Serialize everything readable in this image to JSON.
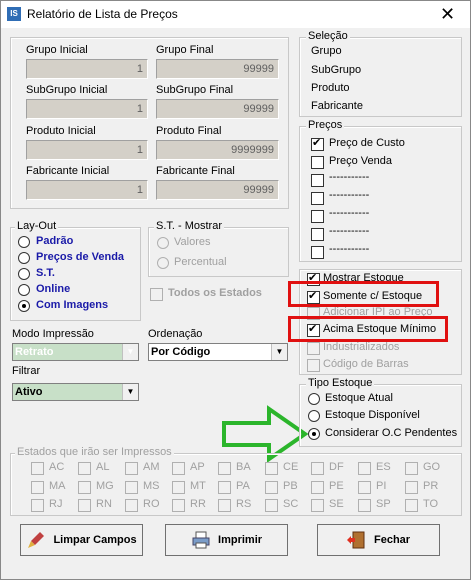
{
  "window": {
    "title": "Relatório de Lista de Preços",
    "icon_text": "IS",
    "close_glyph": "✕"
  },
  "ranges": {
    "grupo_inicial": {
      "label": "Grupo Inicial",
      "value": "1"
    },
    "grupo_final": {
      "label": "Grupo Final",
      "value": "99999"
    },
    "subgrupo_inicial": {
      "label": "SubGrupo Inicial",
      "value": "1"
    },
    "subgrupo_final": {
      "label": "SubGrupo Final",
      "value": "99999"
    },
    "produto_inicial": {
      "label": "Produto Inicial",
      "value": "1"
    },
    "produto_final": {
      "label": "Produto Final",
      "value": "9999999"
    },
    "fabricante_inicial": {
      "label": "Fabricante Inicial",
      "value": "1"
    },
    "fabricante_final": {
      "label": "Fabricante Final",
      "value": "99999"
    }
  },
  "selecao": {
    "title": "Seleção",
    "items": [
      "Grupo",
      "SubGrupo",
      "Produto",
      "Fabricante"
    ]
  },
  "precos": {
    "title": "Preços",
    "items": [
      {
        "label": "Preço de Custo",
        "checked": true
      },
      {
        "label": "Preço Venda",
        "checked": false
      },
      {
        "label": "-----------",
        "checked": false
      },
      {
        "label": "-----------",
        "checked": false
      },
      {
        "label": "-----------",
        "checked": false
      },
      {
        "label": "-----------",
        "checked": false
      },
      {
        "label": "-----------",
        "checked": false
      }
    ]
  },
  "layout": {
    "title": "Lay-Out",
    "options": [
      "Padrão",
      "Preços de Venda",
      "S.T.",
      "Online",
      "Com Imagens"
    ],
    "selected": 4
  },
  "st_mostrar": {
    "title": "S.T. - Mostrar",
    "options": [
      "Valores",
      "Percentual"
    ]
  },
  "todos_estados": "Todos os Estados",
  "opcoes": [
    {
      "label": "Mostrar Estoque",
      "checked": true,
      "disabled": false
    },
    {
      "label": "Somente c/ Estoque",
      "checked": true,
      "disabled": false
    },
    {
      "label": "Adicionar IPI ao Preço",
      "checked": false,
      "disabled": true
    },
    {
      "label": "Acima Estoque Mínimo",
      "checked": true,
      "disabled": false
    },
    {
      "label": "Industrializados",
      "checked": false,
      "disabled": true
    },
    {
      "label": "Código de Barras",
      "checked": false,
      "disabled": true
    }
  ],
  "modo_impressao": {
    "label": "Modo Impressão",
    "value": "Retrato"
  },
  "ordenacao": {
    "label": "Ordenação",
    "value": "Por Código"
  },
  "filtrar": {
    "label": "Filtrar",
    "value": "Ativo"
  },
  "tipo_estoque": {
    "title": "Tipo Estoque",
    "options": [
      "Estoque Atual",
      "Estoque Disponível",
      "Considerar O.C Pendentes"
    ],
    "selected": 2
  },
  "estados": {
    "title": "Estados que irão ser Impressos",
    "rows": [
      [
        "AC",
        "AL",
        "AM",
        "AP",
        "BA",
        "CE",
        "DF",
        "ES",
        "GO"
      ],
      [
        "MA",
        "MG",
        "MS",
        "MT",
        "PA",
        "PB",
        "PE",
        "PI",
        "PR"
      ],
      [
        "RJ",
        "RN",
        "RO",
        "RR",
        "RS",
        "SC",
        "SE",
        "SP",
        "TO"
      ]
    ]
  },
  "buttons": {
    "limpar": "Limpar Campos",
    "imprimir": "Imprimir",
    "fechar": "Fechar"
  },
  "colors": {
    "highlight_red": "#e01010",
    "arrow_green": "#2bb52b",
    "selected_blue": "#1a1aa8"
  }
}
